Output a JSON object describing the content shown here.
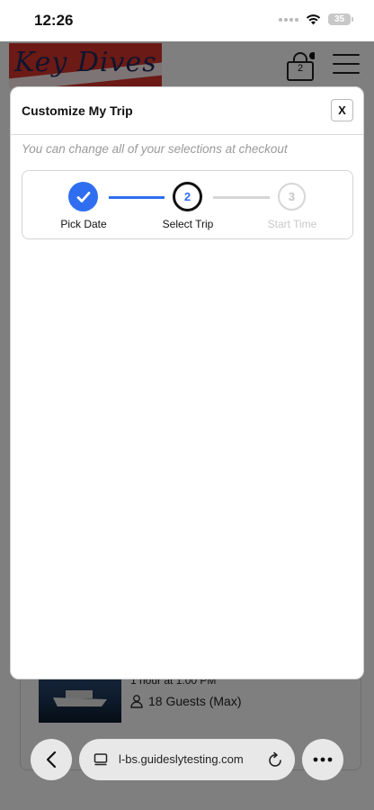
{
  "status": {
    "time": "12:26",
    "battery": "35"
  },
  "header": {
    "logo_text": "Key Dives",
    "cart_count": "2"
  },
  "trip_card": {
    "time": "1 hour at 1:00 PM",
    "guests": "18 Guests (Max)"
  },
  "modal": {
    "title": "Customize My Trip",
    "close_label": "X",
    "note": "You can change all of your selections at checkout",
    "steps": [
      {
        "number": "1",
        "label": "Pick Date",
        "state": "complete"
      },
      {
        "number": "2",
        "label": "Select Trip",
        "state": "active"
      },
      {
        "number": "3",
        "label": "Start Time",
        "state": "pending"
      }
    ]
  },
  "browser": {
    "url": "l-bs.guideslytesting.com"
  },
  "colors": {
    "accent": "#2f6ef0",
    "brand_red": "#d6352d",
    "brand_navy": "#1e2a5a"
  }
}
